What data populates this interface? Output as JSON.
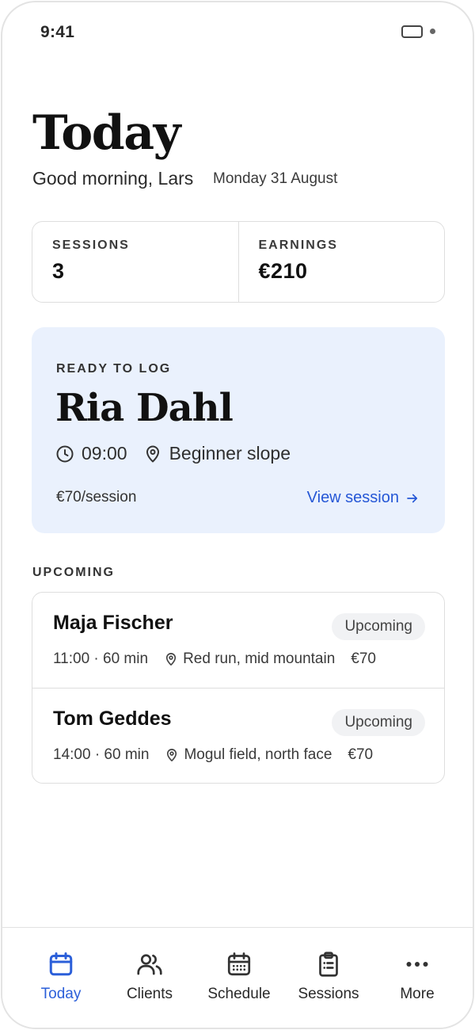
{
  "status_bar": {
    "time": "9:41"
  },
  "header": {
    "title": "Today",
    "greeting": "Good morning, Lars",
    "date": "Monday 31 August"
  },
  "stats": [
    {
      "label": "SESSIONS",
      "value": "3"
    },
    {
      "label": "EARNINGS",
      "value": "€210"
    }
  ],
  "ready_card": {
    "eyebrow": "READY TO LOG",
    "client_name": "Ria Dahl",
    "time": "09:00",
    "location": "Beginner slope",
    "rate": "€70/session",
    "action_label": "View session",
    "background_color": "#eaf1fd",
    "accent_color": "#2557d6"
  },
  "upcoming": {
    "section_label": "UPCOMING",
    "items": [
      {
        "name": "Maja Fischer",
        "status": "Upcoming",
        "time_duration": "11:00 · 60 min",
        "location": "Red run, mid mountain",
        "price": "€70"
      },
      {
        "name": "Tom Geddes",
        "status": "Upcoming",
        "time_duration": "14:00 · 60 min",
        "location": "Mogul field, north face",
        "price": "€70"
      }
    ]
  },
  "tab_bar": {
    "active_color": "#2b5fd9",
    "tabs": [
      {
        "label": "Today",
        "icon": "calendar-icon",
        "active": true
      },
      {
        "label": "Clients",
        "icon": "users-icon",
        "active": false
      },
      {
        "label": "Schedule",
        "icon": "calendar-grid-icon",
        "active": false
      },
      {
        "label": "Sessions",
        "icon": "clipboard-icon",
        "active": false
      },
      {
        "label": "More",
        "icon": "more-icon",
        "active": false
      }
    ]
  }
}
